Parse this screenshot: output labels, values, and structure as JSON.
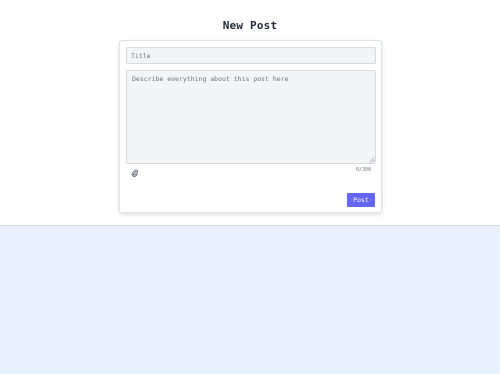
{
  "header": {
    "title": "New Post"
  },
  "form": {
    "title_placeholder": "Title",
    "title_value": "",
    "description_placeholder": "Describe everything about this post here",
    "description_value": "",
    "char_counter": "0/300",
    "attach_icon": "paperclip-icon",
    "post_label": "Post"
  },
  "colors": {
    "accent": "#6366f1",
    "background_lower": "#e8f0fb",
    "field_background": "#f3f4f6"
  }
}
